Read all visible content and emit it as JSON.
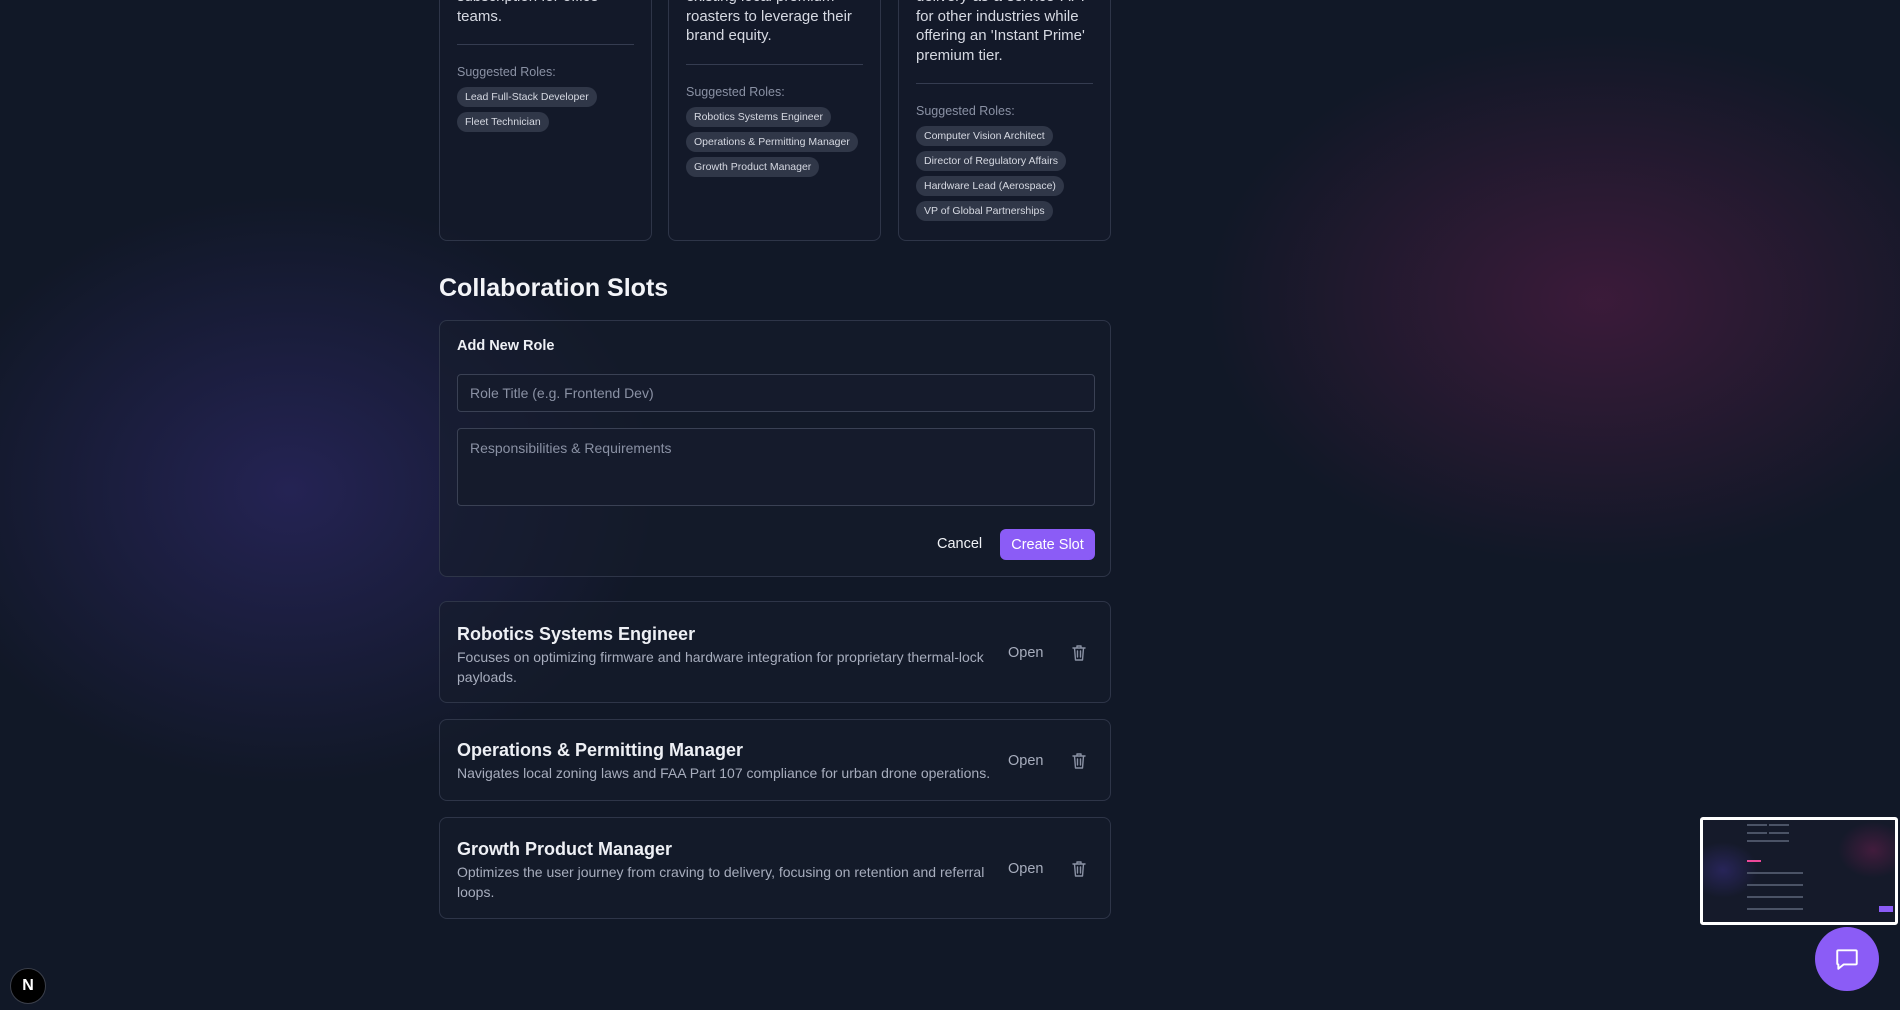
{
  "ideas": [
    {
      "description": "subscription for office teams.",
      "roles_label": "Suggested Roles:",
      "roles": [
        "Lead Full-Stack Developer",
        "Fleet Technician"
      ]
    },
    {
      "description": "existing local premium roasters to leverage their brand equity.",
      "roles_label": "Suggested Roles:",
      "roles": [
        "Robotics Systems Engineer",
        "Operations & Permitting Manager",
        "Growth Product Manager"
      ]
    },
    {
      "description": "delivery-as-a-service' API for other industries while offering an 'Instant Prime' premium tier.",
      "roles_label": "Suggested Roles:",
      "roles": [
        "Computer Vision Architect",
        "Director of Regulatory Affairs",
        "Hardware Lead (Aerospace)",
        "VP of Global Partnerships"
      ]
    }
  ],
  "collaboration": {
    "title": "Collaboration Slots",
    "form": {
      "heading": "Add New Role",
      "role_title_placeholder": "Role Title (e.g. Frontend Dev)",
      "responsibilities_placeholder": "Responsibilities & Requirements",
      "cancel_label": "Cancel",
      "create_label": "Create Slot"
    },
    "slots": [
      {
        "title": "Robotics Systems Engineer",
        "description": "Focuses on optimizing firmware and hardware integration for proprietary thermal-lock payloads.",
        "status": "Open"
      },
      {
        "title": "Operations & Permitting Manager",
        "description": "Navigates local zoning laws and FAA Part 107 compliance for urban drone operations.",
        "status": "Open"
      },
      {
        "title": "Growth Product Manager",
        "description": "Optimizes the user journey from craving to delivery, focusing on retention and referral loops.",
        "status": "Open"
      }
    ]
  },
  "overlay": {
    "badge_letter": "N",
    "chat_icon": "chat-bubble-icon",
    "trash_icon": "trash-icon"
  },
  "colors": {
    "background": "#111827",
    "accent": "#8b5cf6",
    "card_border": "#2e3548",
    "chip_bg": "#303748"
  }
}
